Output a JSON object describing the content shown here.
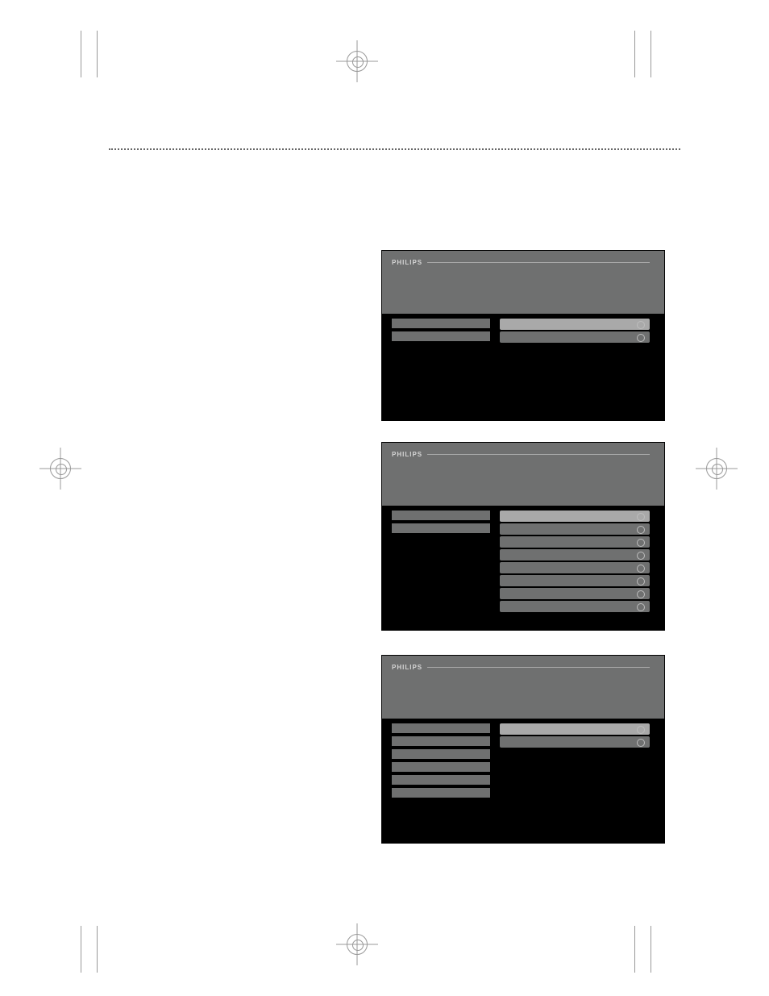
{
  "brand": "PHILIPS",
  "tv1": {
    "left_rows": 2,
    "right_rows": [
      {
        "selected": true
      },
      {
        "selected": false
      }
    ]
  },
  "tv2": {
    "left_rows": 2,
    "right_rows": [
      {
        "selected": true
      },
      {
        "selected": false
      },
      {
        "selected": false
      },
      {
        "selected": false
      },
      {
        "selected": false
      },
      {
        "selected": false
      },
      {
        "selected": false
      },
      {
        "selected": false
      }
    ]
  },
  "tv3": {
    "left_rows": 6,
    "right_rows": [
      {
        "selected": true
      },
      {
        "selected": false
      }
    ]
  }
}
